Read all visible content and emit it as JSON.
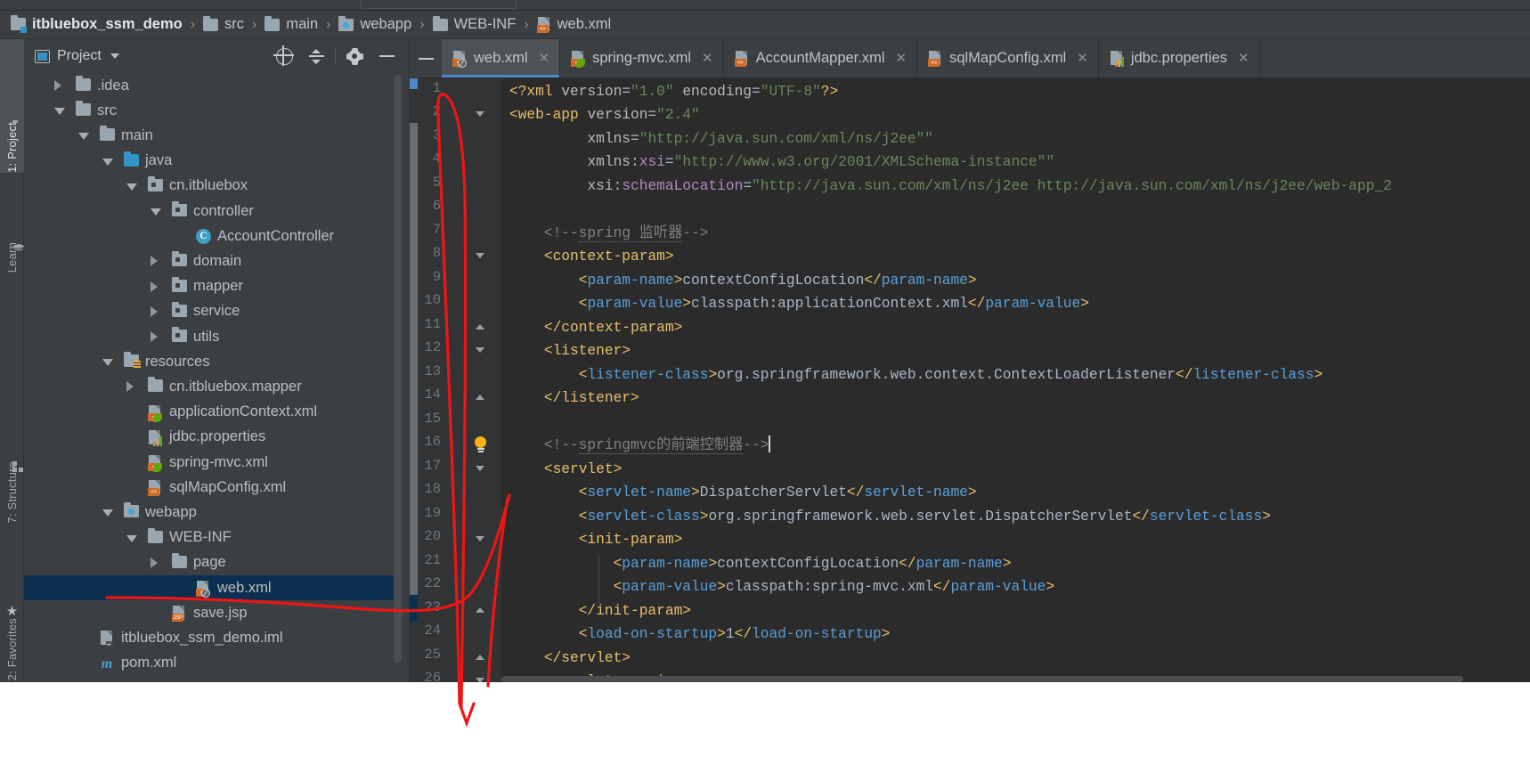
{
  "breadcrumb": [
    {
      "label": "itbluebox_ssm_demo",
      "icon": "module-icon"
    },
    {
      "label": "src",
      "icon": "folder-icon"
    },
    {
      "label": "main",
      "icon": "folder-icon"
    },
    {
      "label": "webapp",
      "icon": "web-folder-icon"
    },
    {
      "label": "WEB-INF",
      "icon": "folder-icon"
    },
    {
      "label": "web.xml",
      "icon": "xml-file-icon"
    }
  ],
  "breadcrumb_separator": "›",
  "rail": {
    "items": [
      {
        "label": "1: Project",
        "icon": "folder-icon",
        "active": true
      },
      {
        "label": "Learn",
        "icon": "learn-icon",
        "active": false
      },
      {
        "label": "7: Structure",
        "icon": "structure-icon",
        "active": false
      },
      {
        "label": "2: Favorites",
        "icon": "star-icon",
        "active": false
      }
    ]
  },
  "project_panel": {
    "title": "Project",
    "actions": [
      {
        "name": "locate-icon",
        "tooltip": "Select Opened File"
      },
      {
        "name": "collapse-all-icon",
        "tooltip": "Collapse All"
      },
      {
        "name": "gear-icon",
        "tooltip": "Settings"
      },
      {
        "name": "minimize-icon",
        "tooltip": "Hide"
      }
    ],
    "tree": [
      {
        "label": ".idea",
        "depth": 1,
        "arrow": "right",
        "icon": "folder-icon",
        "selected": false
      },
      {
        "label": "src",
        "depth": 1,
        "arrow": "down",
        "icon": "folder-icon",
        "selected": false
      },
      {
        "label": "main",
        "depth": 2,
        "arrow": "down",
        "icon": "folder-icon",
        "selected": false
      },
      {
        "label": "java",
        "depth": 3,
        "arrow": "down",
        "icon": "source-folder-icon",
        "selected": false
      },
      {
        "label": "cn.itbluebox",
        "depth": 4,
        "arrow": "down",
        "icon": "package-icon",
        "selected": false
      },
      {
        "label": "controller",
        "depth": 5,
        "arrow": "down",
        "icon": "package-icon",
        "selected": false
      },
      {
        "label": "AccountController",
        "depth": 6,
        "arrow": "none",
        "icon": "java-class-icon",
        "selected": false
      },
      {
        "label": "domain",
        "depth": 5,
        "arrow": "right",
        "icon": "package-icon",
        "selected": false
      },
      {
        "label": "mapper",
        "depth": 5,
        "arrow": "right",
        "icon": "package-icon",
        "selected": false
      },
      {
        "label": "service",
        "depth": 5,
        "arrow": "right",
        "icon": "package-icon",
        "selected": false
      },
      {
        "label": "utils",
        "depth": 5,
        "arrow": "right",
        "icon": "package-icon",
        "selected": false
      },
      {
        "label": "resources",
        "depth": 3,
        "arrow": "down",
        "icon": "resource-folder-icon",
        "selected": false
      },
      {
        "label": "cn.itbluebox.mapper",
        "depth": 4,
        "arrow": "right",
        "icon": "folder-icon",
        "selected": false
      },
      {
        "label": "applicationContext.xml",
        "depth": 4,
        "arrow": "none",
        "icon": "spring-xml-icon",
        "selected": false
      },
      {
        "label": "jdbc.properties",
        "depth": 4,
        "arrow": "none",
        "icon": "properties-icon",
        "selected": false
      },
      {
        "label": "spring-mvc.xml",
        "depth": 4,
        "arrow": "none",
        "icon": "spring-xml-icon",
        "selected": false
      },
      {
        "label": "sqlMapConfig.xml",
        "depth": 4,
        "arrow": "none",
        "icon": "xml-file-icon",
        "selected": false
      },
      {
        "label": "webapp",
        "depth": 3,
        "arrow": "down",
        "icon": "web-folder-icon",
        "selected": false
      },
      {
        "label": "WEB-INF",
        "depth": 4,
        "arrow": "down",
        "icon": "folder-icon",
        "selected": false
      },
      {
        "label": "page",
        "depth": 5,
        "arrow": "right",
        "icon": "folder-icon",
        "selected": false
      },
      {
        "label": "web.xml",
        "depth": 6,
        "arrow": "none",
        "icon": "web-xml-icon",
        "selected": true
      },
      {
        "label": "save.jsp",
        "depth": 5,
        "arrow": "none",
        "icon": "jsp-file-icon",
        "selected": false
      },
      {
        "label": "itbluebox_ssm_demo.iml",
        "depth": 2,
        "arrow": "none",
        "icon": "iml-file-icon",
        "selected": false
      },
      {
        "label": "pom.xml",
        "depth": 2,
        "arrow": "none",
        "icon": "maven-icon",
        "selected": false
      }
    ]
  },
  "editor_tabs": {
    "hide_button": "hide-tabs-icon",
    "tabs": [
      {
        "label": "web.xml",
        "icon": "web-xml-icon",
        "close": "✕",
        "active": true
      },
      {
        "label": "spring-mvc.xml",
        "icon": "spring-xml-icon",
        "close": "✕",
        "active": false
      },
      {
        "label": "AccountMapper.xml",
        "icon": "xml-file-icon",
        "close": "✕",
        "active": false
      },
      {
        "label": "sqlMapConfig.xml",
        "icon": "xml-file-icon",
        "close": "✕",
        "active": false
      },
      {
        "label": "jdbc.properties",
        "icon": "properties-icon",
        "close": "✕",
        "active": false
      }
    ]
  },
  "editor": {
    "file": "web.xml",
    "language": "XML",
    "first_visible_line": 1,
    "last_visible_line": 26,
    "caret_line": 16,
    "lines": [
      {
        "n": 1,
        "fold": "none",
        "text": "<?xml version=\"1.0\" encoding=\"UTF-8\"?>"
      },
      {
        "n": 2,
        "fold": "down",
        "text": "<web-app version=\"2.4\""
      },
      {
        "n": 3,
        "fold": "none",
        "text": "         xmlns=\"http://java.sun.com/xml/ns/j2ee\""
      },
      {
        "n": 4,
        "fold": "none",
        "text": "         xmlns:xsi=\"http://www.w3.org/2001/XMLSchema-instance\""
      },
      {
        "n": 5,
        "fold": "none",
        "text": "         xsi:schemaLocation=\"http://java.sun.com/xml/ns/j2ee http://java.sun.com/xml/ns/j2ee/web-app_2"
      },
      {
        "n": 6,
        "fold": "none",
        "text": ""
      },
      {
        "n": 7,
        "fold": "none",
        "text": "    <!--spring 监听器-->"
      },
      {
        "n": 8,
        "fold": "down",
        "text": "    <context-param>"
      },
      {
        "n": 9,
        "fold": "none",
        "text": "        <param-name>contextConfigLocation</param-name>"
      },
      {
        "n": 10,
        "fold": "none",
        "text": "        <param-value>classpath:applicationContext.xml</param-value>"
      },
      {
        "n": 11,
        "fold": "up",
        "text": "    </context-param>"
      },
      {
        "n": 12,
        "fold": "down",
        "text": "    <listener>"
      },
      {
        "n": 13,
        "fold": "none",
        "text": "        <listener-class>org.springframework.web.context.ContextLoaderListener</listener-class>"
      },
      {
        "n": 14,
        "fold": "up",
        "text": "    </listener>"
      },
      {
        "n": 15,
        "fold": "none",
        "text": ""
      },
      {
        "n": 16,
        "fold": "bulb",
        "text": "    <!--springmvc的前端控制器-->"
      },
      {
        "n": 17,
        "fold": "down",
        "text": "    <servlet>"
      },
      {
        "n": 18,
        "fold": "none",
        "text": "        <servlet-name>DispatcherServlet</servlet-name>"
      },
      {
        "n": 19,
        "fold": "none",
        "text": "        <servlet-class>org.springframework.web.servlet.DispatcherServlet</servlet-class>"
      },
      {
        "n": 20,
        "fold": "down",
        "text": "        <init-param>"
      },
      {
        "n": 21,
        "fold": "none",
        "text": "            <param-name>contextConfigLocation</param-name>"
      },
      {
        "n": 22,
        "fold": "none",
        "text": "            <param-value>classpath:spring-mvc.xml</param-value>"
      },
      {
        "n": 23,
        "fold": "up",
        "text": "        </init-param>"
      },
      {
        "n": 24,
        "fold": "none",
        "text": "        <load-on-startup>1</load-on-startup>"
      },
      {
        "n": 25,
        "fold": "up",
        "text": "    </servlet>"
      },
      {
        "n": 26,
        "fold": "down",
        "text": "    <servlet-mapping>"
      }
    ]
  },
  "annotation": {
    "type": "red-ink-arrow",
    "color": "#f01414",
    "description": "hand-drawn red arrow from web.xml tree node up to line 16/17 of the editor"
  },
  "colors": {
    "ide_chrome": "#3c3f41",
    "editor_bg": "#2b2b2b",
    "gutter_bg": "#313335",
    "selection_blue": "#0d2f4f",
    "tab_active": "#4e5254",
    "tab_underline": "#4a88c7",
    "accent_orange": "#cf6a28",
    "annotation_red": "#f01414"
  }
}
